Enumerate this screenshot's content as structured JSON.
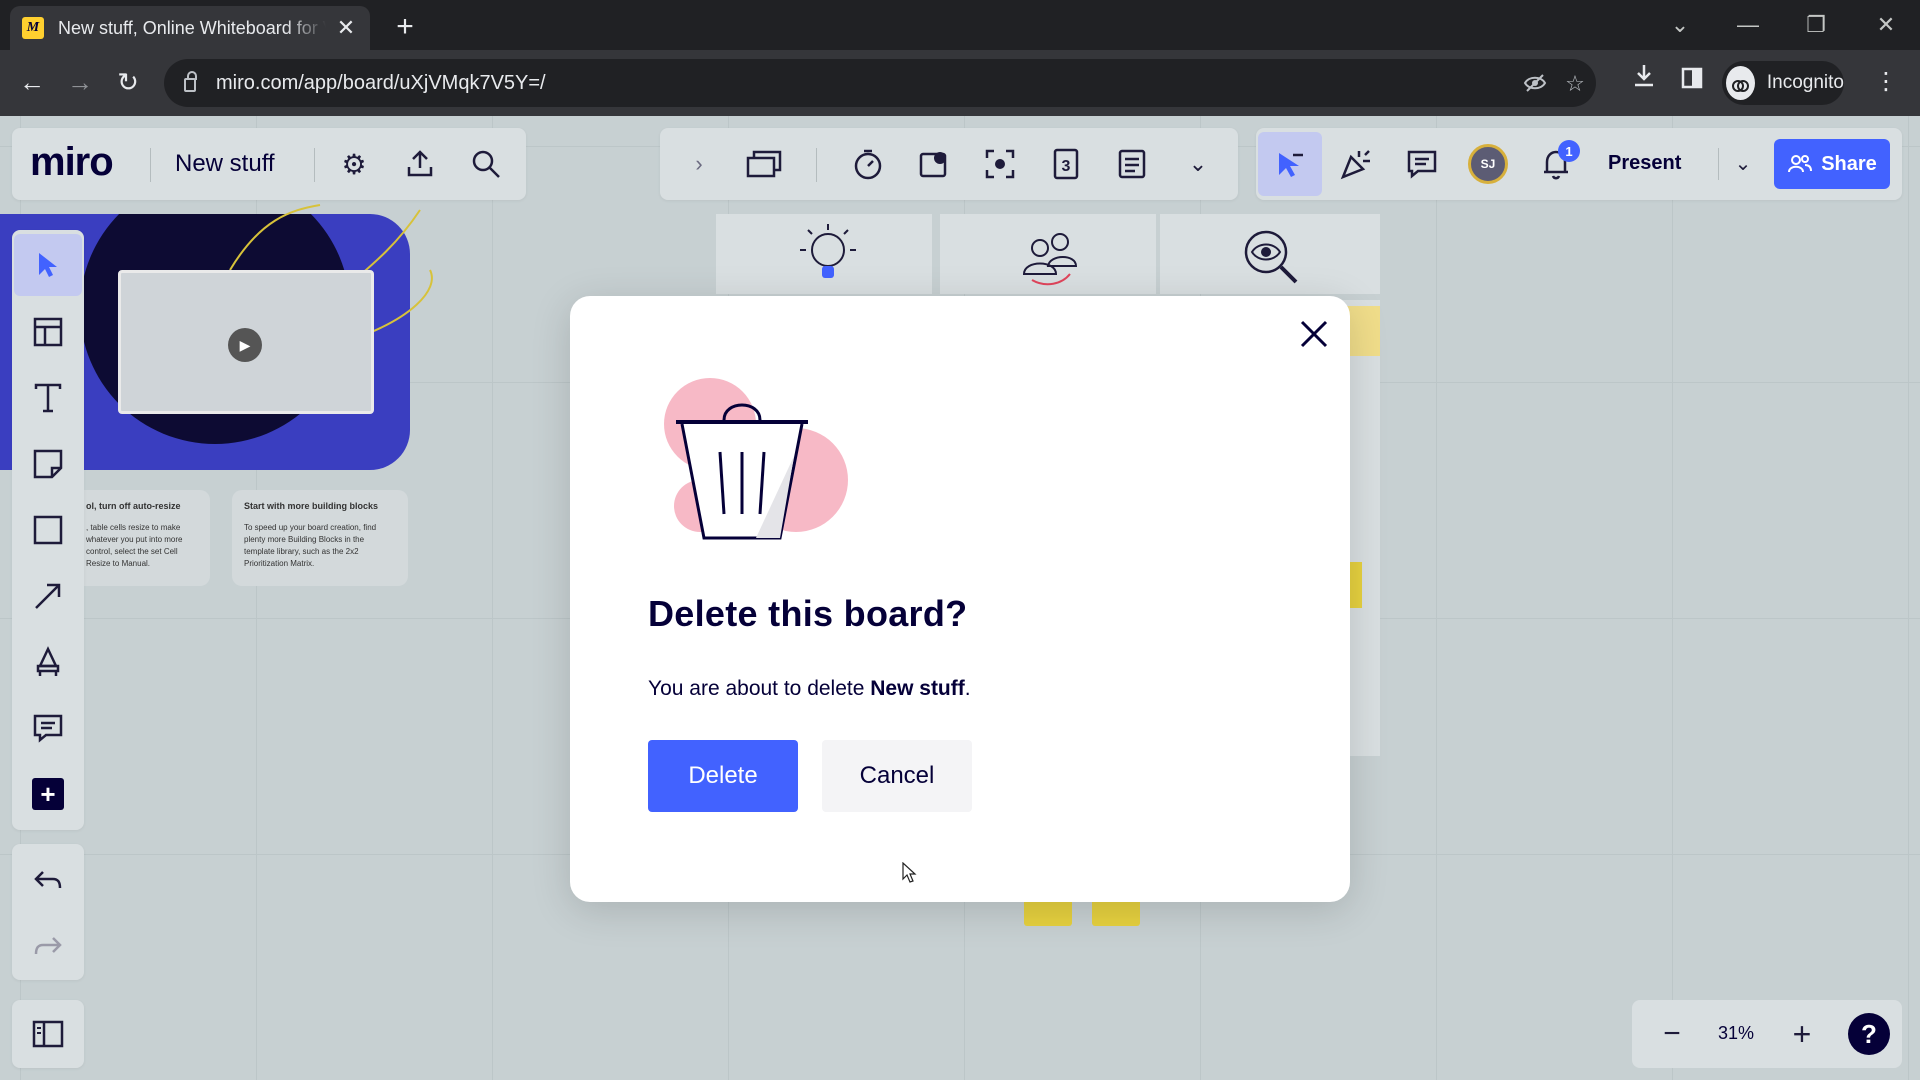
{
  "browser": {
    "tab_title": "New stuff, Online Whiteboard for Visual Collaboration",
    "tab_favicon": "miro-favicon",
    "url": "miro.com/app/board/uXjVMqk7V5Y=/",
    "profile_label": "Incognito"
  },
  "toolbar": {
    "logo": "miro",
    "board_name": "New stuff",
    "present_label": "Present",
    "share_label": "Share",
    "avatar_initials": "SJ",
    "notification_count": "1"
  },
  "board": {
    "card1_title": "ol, turn off auto-resize",
    "card1_body": ", table cells resize to make whatever you put into more control, select the set Cell Resize to Manual.",
    "card2_title": "Start with more building blocks",
    "card2_body": "To speed up your board creation, find plenty more Building Blocks in the template library, such as the 2x2 Prioritization Matrix."
  },
  "zoom": {
    "level": "31%",
    "help": "?"
  },
  "modal": {
    "title": "Delete this board?",
    "text_prefix": "You are about to delete ",
    "board_name": "New stuff",
    "text_suffix": ".",
    "delete_label": "Delete",
    "cancel_label": "Cancel"
  },
  "colors": {
    "accent": "#4262ff",
    "ink": "#050038",
    "trash_bg": "#f7b9c6"
  }
}
